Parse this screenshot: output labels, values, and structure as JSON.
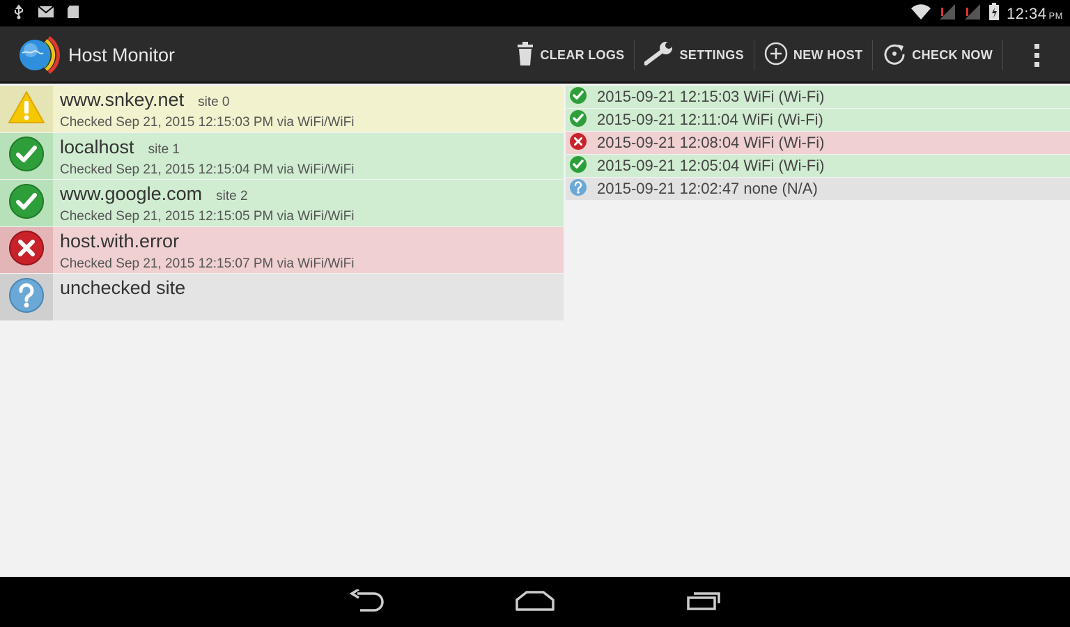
{
  "status_bar": {
    "time": "12:34",
    "ampm": "PM",
    "left_icons": [
      "usb-icon",
      "mail-icon",
      "sd-card-icon"
    ],
    "right_icons": [
      "wifi-icon",
      "signal-icon",
      "signal-icon",
      "battery-icon"
    ]
  },
  "action_bar": {
    "title": "Host Monitor",
    "actions": {
      "clear_logs": "CLEAR LOGS",
      "settings": "SETTINGS",
      "new_host": "NEW HOST",
      "check_now": "CHECK NOW"
    }
  },
  "hosts": [
    {
      "name": "www.snkey.net",
      "site": "site 0",
      "checked": "Checked Sep 21, 2015 12:15:03 PM via WiFi/WiFi",
      "status": "warning"
    },
    {
      "name": "localhost",
      "site": "site 1",
      "checked": "Checked Sep 21, 2015 12:15:04 PM via WiFi/WiFi",
      "status": "ok"
    },
    {
      "name": "www.google.com",
      "site": "site 2",
      "checked": "Checked Sep 21, 2015 12:15:05 PM via WiFi/WiFi",
      "status": "ok"
    },
    {
      "name": "host.with.error",
      "site": "",
      "checked": "Checked Sep 21, 2015 12:15:07 PM via WiFi/WiFi",
      "status": "error"
    },
    {
      "name": "unchecked site",
      "site": "",
      "checked": "",
      "status": "unknown"
    }
  ],
  "logs": [
    {
      "text": "2015-09-21  12:15:03  WiFi (Wi-Fi)",
      "status": "ok"
    },
    {
      "text": "2015-09-21  12:11:04  WiFi (Wi-Fi)",
      "status": "ok"
    },
    {
      "text": "2015-09-21  12:08:04  WiFi (Wi-Fi)",
      "status": "error"
    },
    {
      "text": "2015-09-21  12:05:04  WiFi (Wi-Fi)",
      "status": "ok"
    },
    {
      "text": "2015-09-21  12:02:47  none (N/A)",
      "status": "unknown"
    }
  ],
  "colors": {
    "ok": "#2e9e3a",
    "error": "#c8232b",
    "warning": "#f4c400",
    "unknown": "#5a9ac8"
  }
}
